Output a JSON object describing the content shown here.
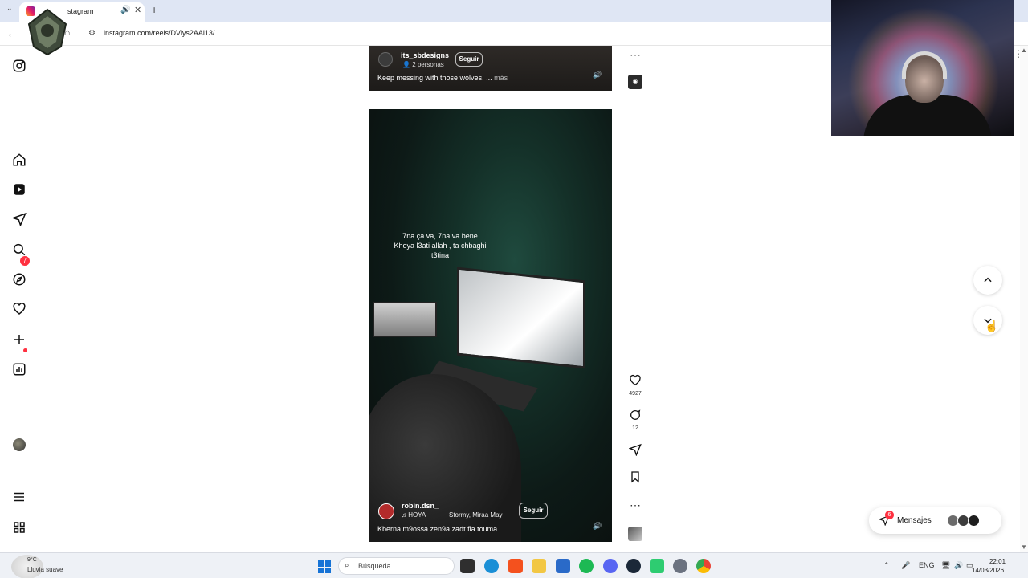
{
  "browser": {
    "tab_title": "Instagram",
    "tab_title_visible": "stagram",
    "url": "instagram.com/reels/DViys2AAi13/"
  },
  "nav": {
    "notifications_badge": "7",
    "icons": [
      "instagram-logo-icon",
      "home-icon",
      "reels-icon",
      "direct-icon",
      "search-icon",
      "explore-icon",
      "heart-icon",
      "create-icon",
      "dashboard-icon",
      "profile-avatar",
      "menu-icon",
      "meta-apps-icon"
    ]
  },
  "reel_top": {
    "username": "its_sbdesigns",
    "collaborators": "2 personas",
    "follow_label": "Seguir",
    "caption": "Keep messing with those wolves. ...",
    "more_label": "más"
  },
  "reel_main": {
    "overlay_text_line1": "7na ça va, 7na va bene",
    "overlay_text_line2": "Khoya l3ati allah , ta chbaghi",
    "overlay_text_line3": "t3tina",
    "username": "robin.dsn_",
    "music": "♫  HOYA",
    "artists": "Stormy, Miraa May",
    "follow_label": "Seguir",
    "caption": "Kberna m9ossa zen9a zadt fia touma",
    "likes": "4927",
    "comments": "12"
  },
  "messages": {
    "label": "Mensajes",
    "badge": "6"
  },
  "taskbar": {
    "weather_temp": "9°C",
    "weather_desc": "Lluvia suave",
    "search_placeholder": "Búsqueda",
    "language": "ENG",
    "time": "22:01",
    "date": "14/03/2026"
  },
  "colors": {
    "badge_red": "#ff3040",
    "windows_blue": "#1673d6",
    "reel_green": "#1f4a3e"
  }
}
